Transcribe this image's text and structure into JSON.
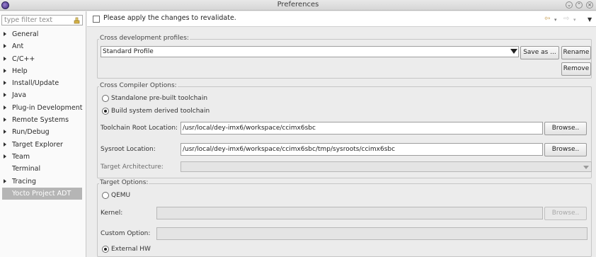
{
  "window": {
    "title": "Preferences",
    "controls": [
      "minimize-icon",
      "maximize-icon",
      "close-icon"
    ]
  },
  "sidebar": {
    "filter_placeholder": "type filter text",
    "items": [
      {
        "label": "General",
        "expandable": true
      },
      {
        "label": "Ant",
        "expandable": true
      },
      {
        "label": "C/C++",
        "expandable": true
      },
      {
        "label": "Help",
        "expandable": true
      },
      {
        "label": "Install/Update",
        "expandable": true
      },
      {
        "label": "Java",
        "expandable": true
      },
      {
        "label": "Plug-in Development",
        "expandable": true
      },
      {
        "label": "Remote Systems",
        "expandable": true
      },
      {
        "label": "Run/Debug",
        "expandable": true
      },
      {
        "label": "Target Explorer",
        "expandable": true
      },
      {
        "label": "Team",
        "expandable": true
      },
      {
        "label": "Terminal",
        "expandable": false
      },
      {
        "label": "Tracing",
        "expandable": true
      },
      {
        "label": "Yocto Project ADT",
        "expandable": false,
        "selected": true
      }
    ]
  },
  "message": {
    "text": "Please apply the changes to revalidate."
  },
  "profiles": {
    "group_label": "Cross development profiles:",
    "selected": "Standard Profile",
    "save_as_label": "Save as ...",
    "rename_label": "Rename",
    "remove_label": "Remove"
  },
  "compiler": {
    "group_label": "Cross Compiler Options:",
    "option_standalone": "Standalone pre-built toolchain",
    "option_build_system": "Build system derived toolchain",
    "selected_option": "Build system derived toolchain",
    "toolchain_root_label": "Toolchain Root Location:",
    "toolchain_root_value": "/usr/local/dey-imx6/workspace/ccimx6sbc",
    "sysroot_label": "Sysroot Location:",
    "sysroot_value": "/usr/local/dey-imx6/workspace/ccimx6sbc/tmp/sysroots/ccimx6sbc",
    "browse_label": "Browse..",
    "target_arch_label": "Target Architecture:",
    "target_arch_value": ""
  },
  "target": {
    "group_label": "Target Options:",
    "option_qemu": "QEMU",
    "kernel_label": "Kernel:",
    "kernel_value": "",
    "browse_label": "Browse..",
    "custom_option_label": "Custom Option:",
    "custom_option_value": "",
    "option_external": "External HW",
    "selected_option": "External HW"
  },
  "colors": {
    "selection_bg": "#b5b5b5",
    "nav_arrow": "#c9a25a"
  }
}
